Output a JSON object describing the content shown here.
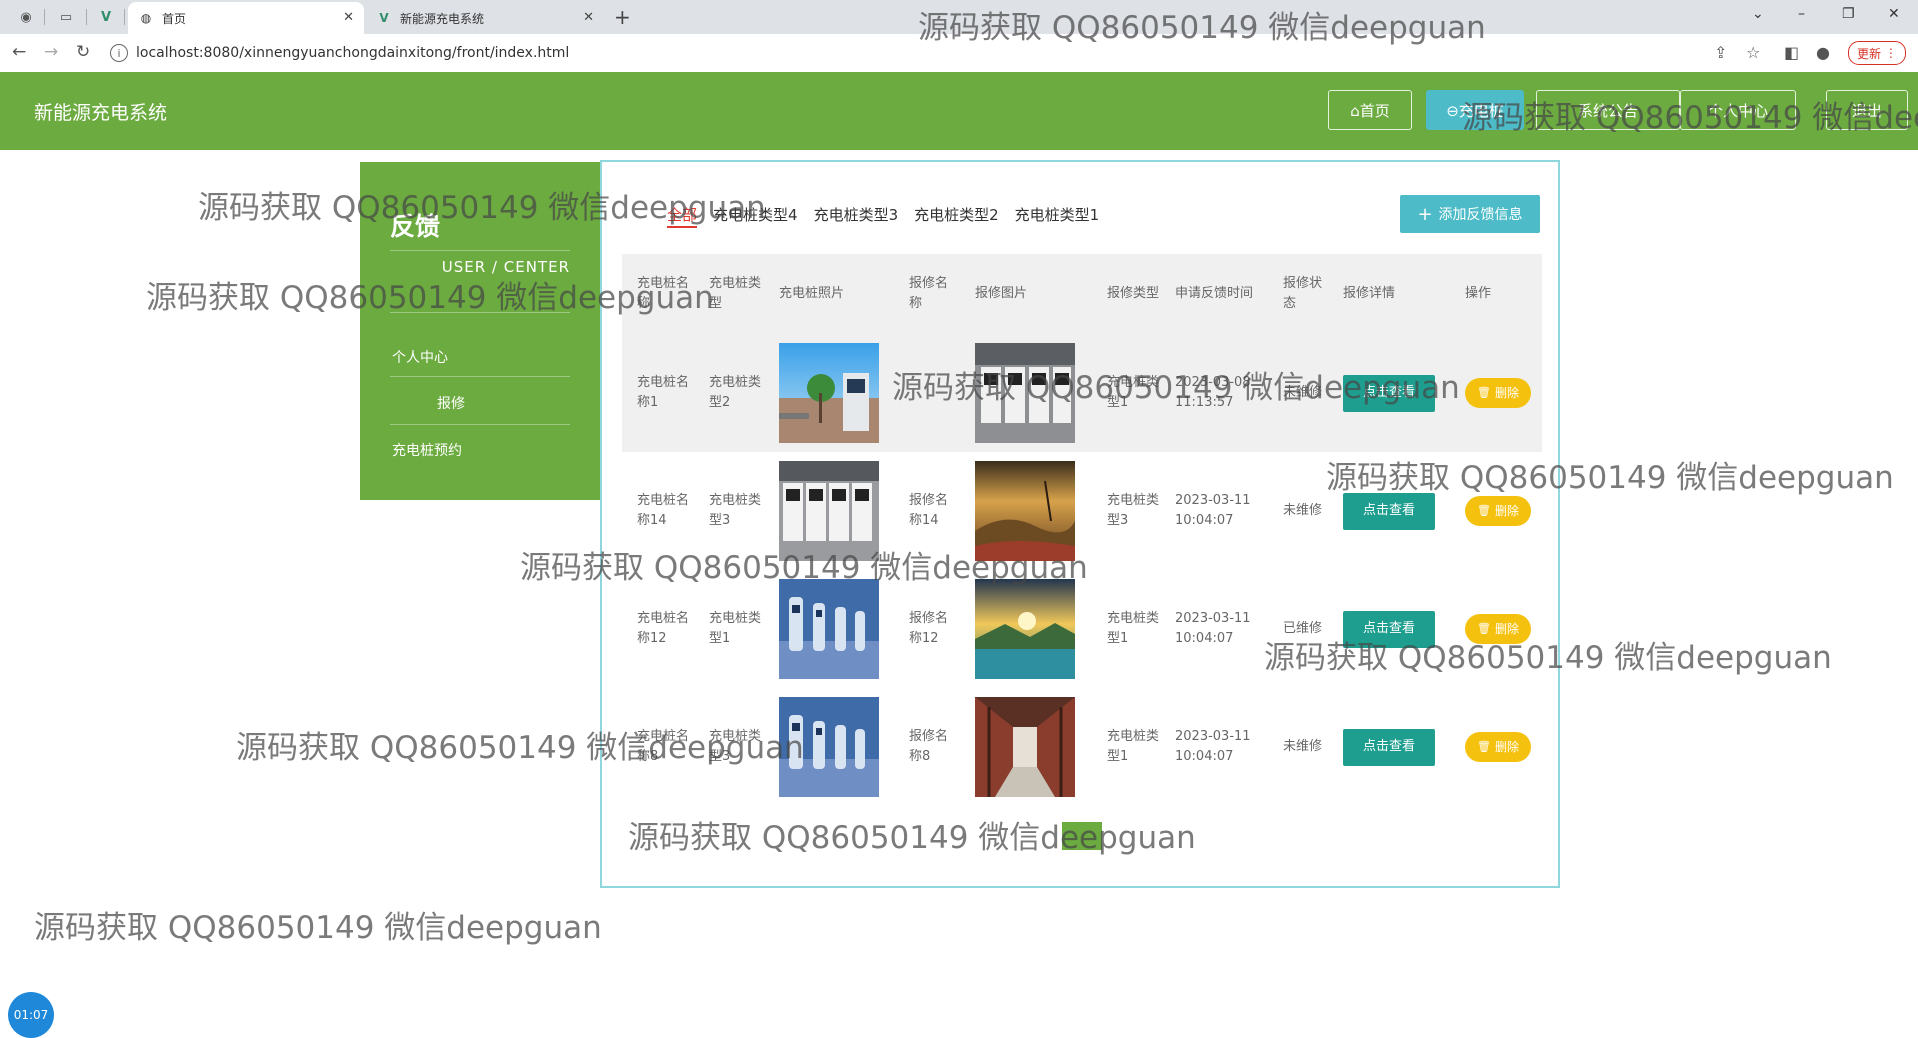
{
  "browser": {
    "tabs": [
      {
        "label": "首页",
        "icon": "globe-icon"
      },
      {
        "label": "新能源充电系统",
        "icon": "vue-logo-icon"
      }
    ],
    "url": "localhost:8080/xinnengyuanchongdainxitong/front/index.html",
    "update_label": "更新"
  },
  "header": {
    "site_title": "新能源充电系统",
    "nav": [
      {
        "label": "⌂首页"
      },
      {
        "label": "⊖充电桩",
        "active": true
      },
      {
        "label": "系统公告"
      },
      {
        "label": "个人中心"
      },
      {
        "label": "退出"
      }
    ]
  },
  "side": {
    "title": "反馈",
    "subtitle": "USER / CENTER",
    "items": [
      {
        "label": "个人中心"
      },
      {
        "label": "报修"
      },
      {
        "label": "充电桩预约"
      }
    ]
  },
  "filters": [
    "全部",
    "充电桩类型4",
    "充电桩类型3",
    "充电桩类型2",
    "充电桩类型1"
  ],
  "add_button": "添加反馈信息",
  "table": {
    "headers": [
      "充电桩名称",
      "充电桩类型",
      "充电桩照片",
      "报修名称",
      "报修图片",
      "报修类型",
      "申请反馈时间",
      "报修状态",
      "报修详情",
      "操作"
    ],
    "view_label": "点击查看",
    "delete_label": "删除",
    "rows": [
      {
        "name": "充电桩名称1",
        "type": "充电桩类型2",
        "repair_name": "",
        "repair_type": "充电桩类型1",
        "time": "2023-03-08 11:13:57",
        "status": "未维修"
      },
      {
        "name": "充电桩名称14",
        "type": "充电桩类型3",
        "repair_name": "报修名称14",
        "repair_type": "充电桩类型3",
        "time": "2023-03-11 10:04:07",
        "status": "未维修"
      },
      {
        "name": "充电桩名称12",
        "type": "充电桩类型1",
        "repair_name": "报修名称12",
        "repair_type": "充电桩类型1",
        "time": "2023-03-11 10:04:07",
        "status": "已维修"
      },
      {
        "name": "充电桩名称8",
        "type": "充电桩类型3",
        "repair_name": "报修名称8",
        "repair_type": "充电桩类型1",
        "time": "2023-03-11 10:04:07",
        "status": "未维修"
      }
    ]
  },
  "watermark": "源码获取 QQ86050149 微信deepguan",
  "timer": "01:07"
}
